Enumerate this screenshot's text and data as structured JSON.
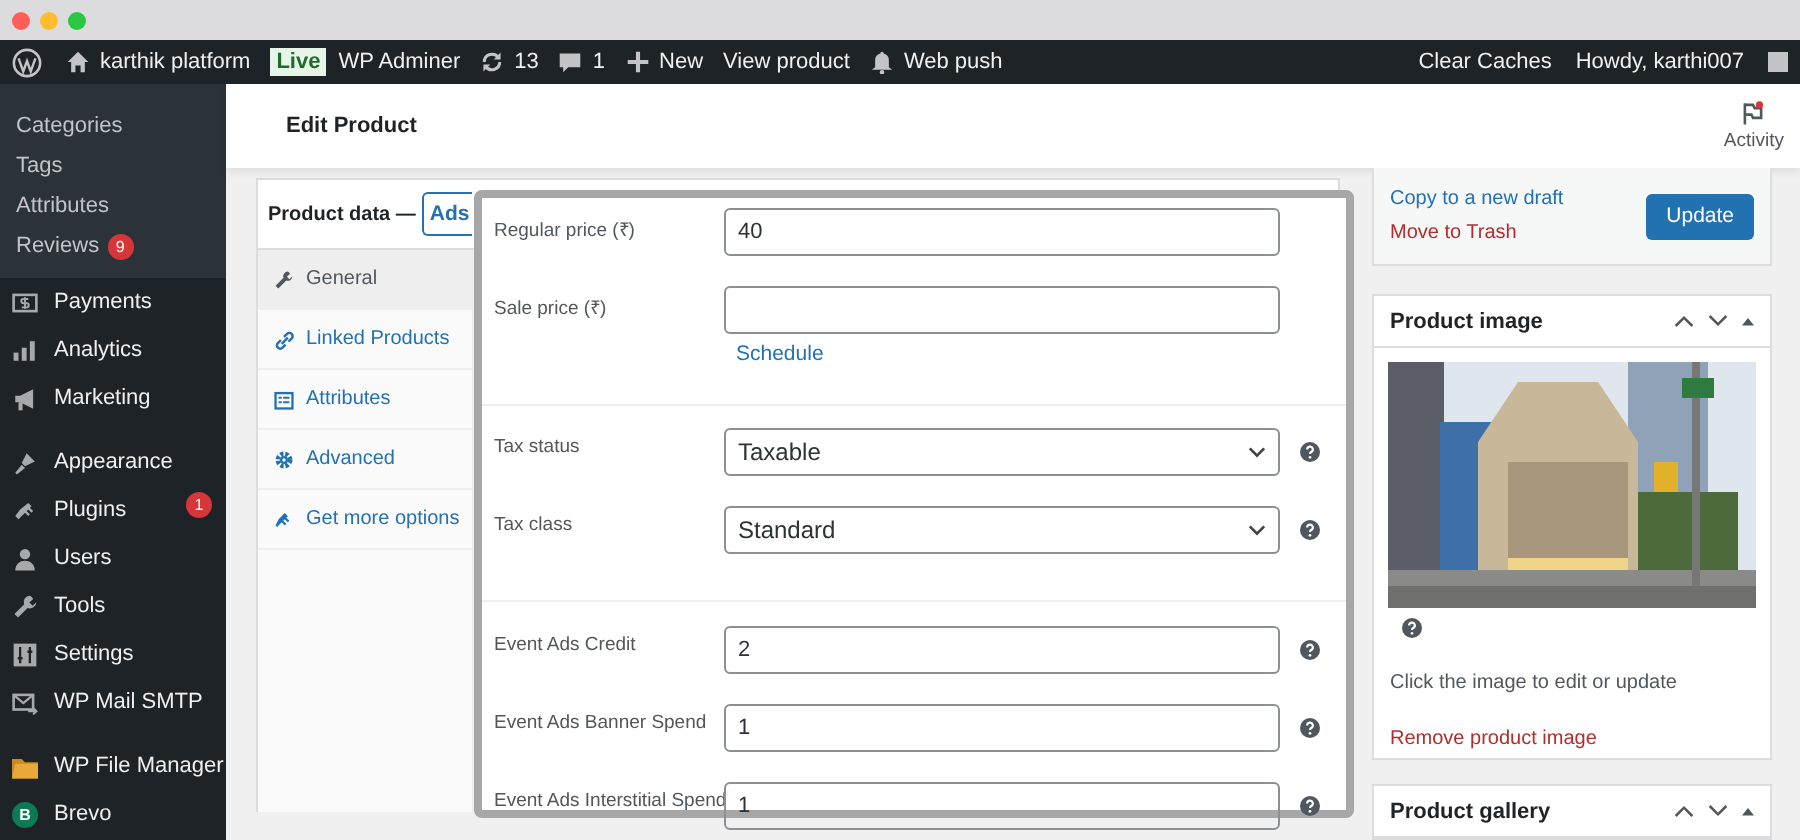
{
  "admin_bar": {
    "site": "karthik platform",
    "live_badge": "Live",
    "items": [
      {
        "kind": "text",
        "label": "WP Adminer"
      },
      {
        "kind": "updates",
        "label": "13"
      },
      {
        "kind": "comments",
        "label": "1"
      },
      {
        "kind": "new",
        "label": "New"
      },
      {
        "kind": "text",
        "label": "View product"
      },
      {
        "kind": "bell",
        "label": "Web push"
      }
    ],
    "right": [
      "Clear Caches",
      "Howdy, karthi007"
    ]
  },
  "sidebar": {
    "submenu": [
      {
        "label": "Categories"
      },
      {
        "label": "Tags"
      },
      {
        "label": "Attributes"
      },
      {
        "label": "Reviews",
        "badge": "9"
      }
    ],
    "groups": [
      [
        {
          "kind": "payments",
          "label": "Payments"
        },
        {
          "kind": "analytics",
          "label": "Analytics"
        },
        {
          "kind": "marketing",
          "label": "Marketing"
        }
      ],
      [
        {
          "kind": "appearance",
          "label": "Appearance"
        },
        {
          "kind": "plugins",
          "label": "Plugins",
          "badge": "1"
        },
        {
          "kind": "users",
          "label": "Users"
        },
        {
          "kind": "tools",
          "label": "Tools"
        },
        {
          "kind": "settings",
          "label": "Settings"
        },
        {
          "kind": "mail",
          "label": "WP Mail SMTP"
        }
      ],
      [
        {
          "kind": "folder",
          "label": "WP File Manager"
        },
        {
          "kind": "logo",
          "logo": "B",
          "label": "Brevo"
        }
      ]
    ]
  },
  "header": {
    "title": "Edit Product",
    "activity": "Activity"
  },
  "product_data": {
    "title": "Product data —",
    "type": "Ads",
    "tabs": [
      {
        "kind": "general",
        "label": "General",
        "selected": true
      },
      {
        "kind": "linked",
        "label": "Linked Products",
        "selected": false
      },
      {
        "kind": "attributes",
        "label": "Attributes",
        "selected": false
      },
      {
        "kind": "advanced",
        "label": "Advanced",
        "selected": false
      },
      {
        "kind": "more",
        "label": "Get more options",
        "selected": false
      }
    ]
  },
  "general_panel": {
    "sections": [
      [
        {
          "kind": "input",
          "label": "Regular price (₹)",
          "value": "40",
          "help": false
        },
        {
          "kind": "input",
          "label": "Sale price (₹)",
          "link": "Schedule",
          "help": false
        }
      ],
      [
        {
          "kind": "select",
          "label": "Tax status",
          "value": "Taxable",
          "help": true
        },
        {
          "kind": "select",
          "label": "Tax class",
          "value": "Standard",
          "help": true
        }
      ],
      [
        {
          "kind": "input",
          "label": "Event Ads Credit",
          "value": "2",
          "help": true
        },
        {
          "kind": "input",
          "label": "Event Ads Banner Spend",
          "value": "1",
          "help": true
        },
        {
          "kind": "input",
          "label": "Event Ads Interstitial Spend",
          "value": "1",
          "help": true
        }
      ]
    ]
  },
  "publish": {
    "copy_link": "Copy to a new draft",
    "trash_link": "Move to Trash",
    "button": "Update"
  },
  "product_image": {
    "title": "Product image",
    "hint": "Click the image to edit or update",
    "remove_link": "Remove product image"
  },
  "product_gallery": {
    "title": "Product gallery"
  }
}
